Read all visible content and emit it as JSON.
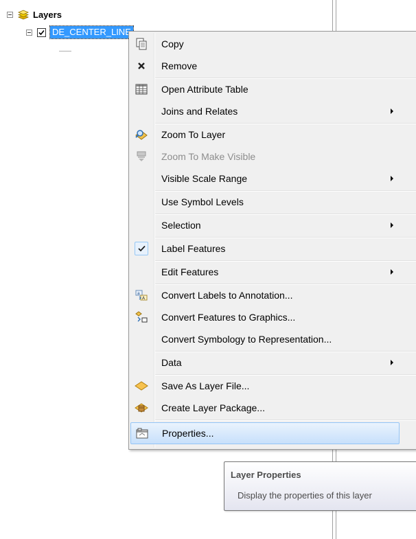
{
  "toc": {
    "root_label": "Layers",
    "layer_name": "DE_CENTER_LINE"
  },
  "context_menu": {
    "items": [
      {
        "label": "Copy",
        "icon": "copy-icon",
        "submenu": false,
        "enabled": true
      },
      {
        "label": "Remove",
        "icon": "remove-x-icon",
        "submenu": false,
        "enabled": true
      },
      {
        "label": "Open Attribute Table",
        "icon": "table-icon",
        "submenu": false,
        "enabled": true
      },
      {
        "label": "Joins and Relates",
        "icon": "",
        "submenu": true,
        "enabled": true
      },
      {
        "label": "Zoom To Layer",
        "icon": "zoom-to-layer-icon",
        "submenu": false,
        "enabled": true
      },
      {
        "label": "Zoom To Make Visible",
        "icon": "zoom-to-make-visible-icon",
        "submenu": false,
        "enabled": false
      },
      {
        "label": "Visible Scale Range",
        "icon": "",
        "submenu": true,
        "enabled": true
      },
      {
        "label": "Use Symbol Levels",
        "icon": "",
        "submenu": false,
        "enabled": true
      },
      {
        "label": "Selection",
        "icon": "",
        "submenu": true,
        "enabled": true
      },
      {
        "label": "Label Features",
        "icon": "checkmark-icon",
        "submenu": false,
        "enabled": true,
        "checked": true
      },
      {
        "label": "Edit Features",
        "icon": "",
        "submenu": true,
        "enabled": true
      },
      {
        "label": "Convert Labels to Annotation...",
        "icon": "convert-labels-icon",
        "submenu": false,
        "enabled": true
      },
      {
        "label": "Convert Features to Graphics...",
        "icon": "convert-graphics-icon",
        "submenu": false,
        "enabled": true
      },
      {
        "label": "Convert Symbology to Representation...",
        "icon": "",
        "submenu": false,
        "enabled": true
      },
      {
        "label": "Data",
        "icon": "",
        "submenu": true,
        "enabled": true
      },
      {
        "label": "Save As Layer File...",
        "icon": "layer-file-icon",
        "submenu": false,
        "enabled": true
      },
      {
        "label": "Create Layer Package...",
        "icon": "layer-package-icon",
        "submenu": false,
        "enabled": true
      },
      {
        "label": "Properties...",
        "icon": "properties-icon",
        "submenu": false,
        "enabled": true,
        "hovered": true
      }
    ]
  },
  "tooltip": {
    "title": "Layer Properties",
    "description": "Display the properties of this layer"
  },
  "colors": {
    "selection": "#3399ff",
    "menu_background": "#f0f0f0",
    "hover_border": "#93c4f6",
    "disabled_text": "#8d8d8d"
  }
}
